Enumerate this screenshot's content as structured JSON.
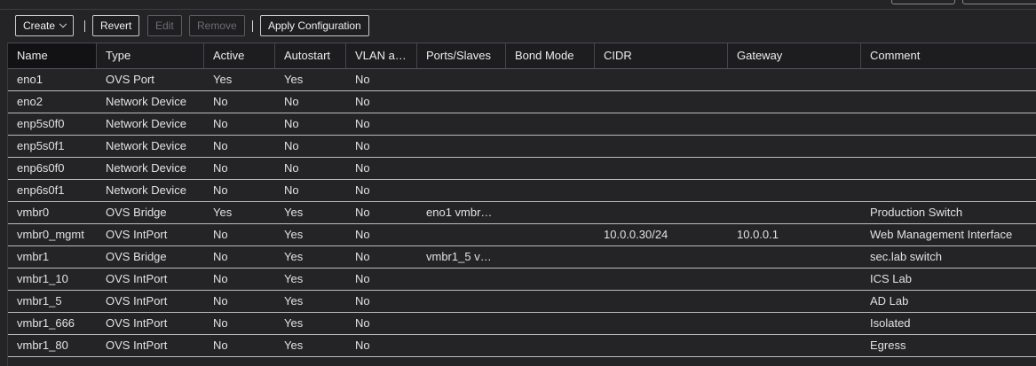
{
  "toolbar": {
    "create_label": "Create",
    "revert_label": "Revert",
    "edit_label": "Edit",
    "remove_label": "Remove",
    "apply_label": "Apply Configuration"
  },
  "columns": [
    "Name",
    "Type",
    "Active",
    "Autostart",
    "VLAN a…",
    "Ports/Slaves",
    "Bond Mode",
    "CIDR",
    "Gateway",
    "Comment"
  ],
  "rows": [
    [
      "eno1",
      "OVS Port",
      "Yes",
      "Yes",
      "No",
      "",
      "",
      "",
      "",
      ""
    ],
    [
      "eno2",
      "Network Device",
      "No",
      "No",
      "No",
      "",
      "",
      "",
      "",
      ""
    ],
    [
      "enp5s0f0",
      "Network Device",
      "No",
      "No",
      "No",
      "",
      "",
      "",
      "",
      ""
    ],
    [
      "enp5s0f1",
      "Network Device",
      "No",
      "No",
      "No",
      "",
      "",
      "",
      "",
      ""
    ],
    [
      "enp6s0f0",
      "Network Device",
      "No",
      "No",
      "No",
      "",
      "",
      "",
      "",
      ""
    ],
    [
      "enp6s0f1",
      "Network Device",
      "No",
      "No",
      "No",
      "",
      "",
      "",
      "",
      ""
    ],
    [
      "vmbr0",
      "OVS Bridge",
      "Yes",
      "Yes",
      "No",
      "eno1 vmbr…",
      "",
      "",
      "",
      "Production Switch"
    ],
    [
      "vmbr0_mgmt",
      "OVS IntPort",
      "No",
      "Yes",
      "No",
      "",
      "",
      "10.0.0.30/24",
      "10.0.0.1",
      "Web Management Interface"
    ],
    [
      "vmbr1",
      "OVS Bridge",
      "No",
      "Yes",
      "No",
      "vmbr1_5 v…",
      "",
      "",
      "",
      "sec.lab switch"
    ],
    [
      "vmbr1_10",
      "OVS IntPort",
      "No",
      "Yes",
      "No",
      "",
      "",
      "",
      "",
      "ICS Lab"
    ],
    [
      "vmbr1_5",
      "OVS IntPort",
      "No",
      "Yes",
      "No",
      "",
      "",
      "",
      "",
      "AD Lab"
    ],
    [
      "vmbr1_666",
      "OVS IntPort",
      "No",
      "Yes",
      "No",
      "",
      "",
      "",
      "",
      "Isolated"
    ],
    [
      "vmbr1_80",
      "OVS IntPort",
      "No",
      "Yes",
      "No",
      "",
      "",
      "",
      "",
      "Egress"
    ]
  ]
}
